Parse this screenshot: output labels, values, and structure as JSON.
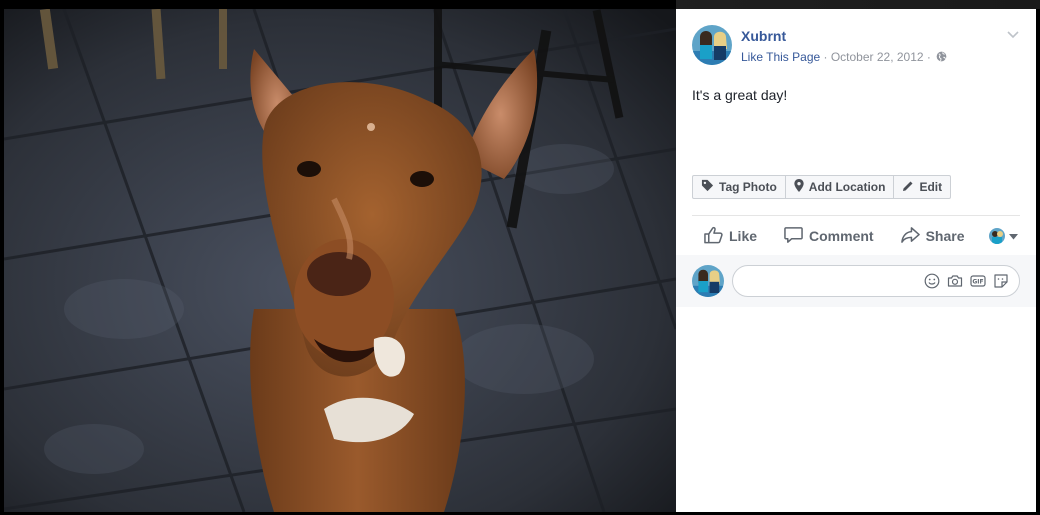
{
  "post": {
    "author": "Xubrnt",
    "like_page": "Like This Page",
    "separator": " · ",
    "date": "October 22, 2012",
    "text": "It's a great day!"
  },
  "photo_actions": {
    "tag_photo": "Tag Photo",
    "add_location": "Add Location",
    "edit": "Edit"
  },
  "ufi": {
    "like": "Like",
    "comment": "Comment",
    "share": "Share"
  },
  "comment_box": {
    "placeholder": ""
  },
  "icons": {
    "header_menu": "chevron-down-icon",
    "audience": "globe-icon",
    "tag": "tag-icon",
    "location": "map-pin-icon",
    "edit": "pencil-icon",
    "like": "thumbs-up-icon",
    "comment": "speech-bubble-icon",
    "share": "share-arrow-icon",
    "emoji": "smiley-icon",
    "camera": "camera-icon",
    "gif": "gif-icon",
    "sticker": "sticker-icon"
  },
  "colors": {
    "link": "#365899",
    "meta": "#90949c",
    "action_text": "#606770",
    "panel_bg": "#ffffff",
    "stage_bg": "#000000"
  }
}
